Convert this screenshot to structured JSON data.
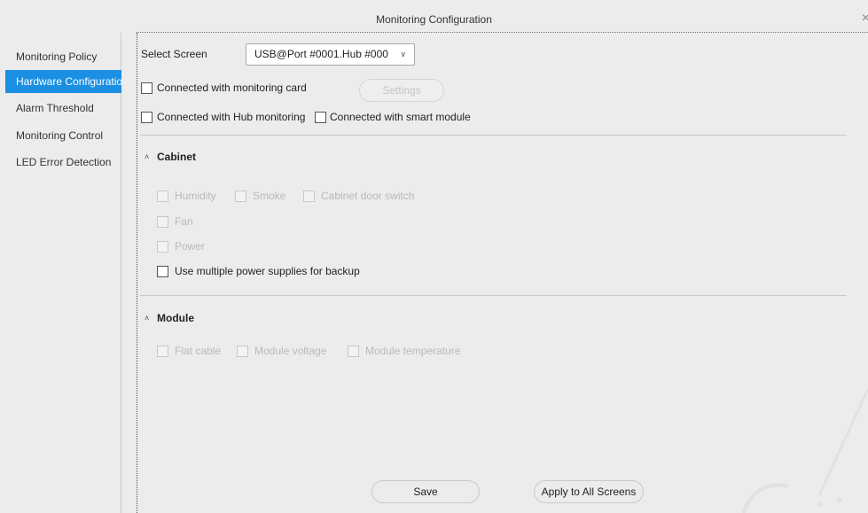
{
  "window": {
    "title": "Monitoring Configuration",
    "close_glyph": "×"
  },
  "sidebar": {
    "items": [
      {
        "label": "Monitoring Policy"
      },
      {
        "label": "Hardware Configuration"
      },
      {
        "label": "Alarm Threshold"
      },
      {
        "label": "Monitoring Control"
      },
      {
        "label": "LED Error Detection"
      }
    ],
    "active_index": 1
  },
  "screen_select": {
    "label": "Select Screen",
    "value": "USB@Port #0001.Hub #000"
  },
  "connections": {
    "monitoring_card": {
      "label": "Connected with monitoring card",
      "checked": false
    },
    "settings_button": "Settings",
    "hub_monitoring": {
      "label": "Connected with Hub monitoring",
      "checked": false
    },
    "smart_module": {
      "label": "Connected with smart module",
      "checked": false
    }
  },
  "cabinet": {
    "title": "Cabinet",
    "humidity": "Humidity",
    "smoke": "Smoke",
    "door_switch": "Cabinet door switch",
    "fan": "Fan",
    "power": "Power",
    "backup": "Use multiple power supplies for backup"
  },
  "module": {
    "title": "Module",
    "flat_cable": "Flat cable",
    "voltage": "Module voltage",
    "temperature": "Module temperature"
  },
  "footer": {
    "save": "Save",
    "apply_all": "Apply to All Screens"
  },
  "colors": {
    "accent": "#1a8fe3",
    "background": "#ececec"
  }
}
